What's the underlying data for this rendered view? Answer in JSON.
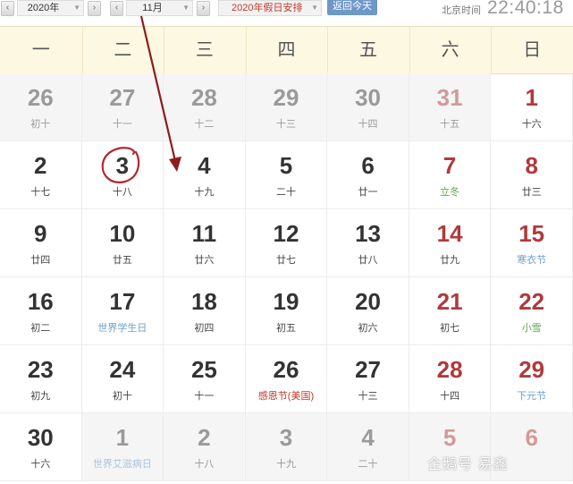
{
  "toolbar": {
    "year_value": "2020年",
    "month_value": "11月",
    "holiday_label": "2020年假日安排",
    "today_button": "返回今天",
    "beijing_label": "北京时间",
    "clock": "22:40:18"
  },
  "weekdays": [
    "一",
    "二",
    "三",
    "四",
    "五",
    "六",
    "日"
  ],
  "weeks": [
    [
      {
        "day": "26",
        "sub": "初十",
        "other": true
      },
      {
        "day": "27",
        "sub": "十一",
        "other": true
      },
      {
        "day": "28",
        "sub": "十二",
        "other": true
      },
      {
        "day": "29",
        "sub": "十三",
        "other": true
      },
      {
        "day": "30",
        "sub": "十四",
        "other": true
      },
      {
        "day": "31",
        "sub": "十五",
        "other": true,
        "weekend": true
      },
      {
        "day": "1",
        "sub": "十六",
        "weekend": true
      }
    ],
    [
      {
        "day": "2",
        "sub": "十七"
      },
      {
        "day": "3",
        "sub": "十八"
      },
      {
        "day": "4",
        "sub": "十九"
      },
      {
        "day": "5",
        "sub": "二十"
      },
      {
        "day": "6",
        "sub": "廿一"
      },
      {
        "day": "7",
        "sub": "立冬",
        "weekend": true,
        "subType": "term"
      },
      {
        "day": "8",
        "sub": "廿三",
        "weekend": true
      }
    ],
    [
      {
        "day": "9",
        "sub": "廿四"
      },
      {
        "day": "10",
        "sub": "廿五"
      },
      {
        "day": "11",
        "sub": "廿六"
      },
      {
        "day": "12",
        "sub": "廿七"
      },
      {
        "day": "13",
        "sub": "廿八"
      },
      {
        "day": "14",
        "sub": "廿九",
        "weekend": true
      },
      {
        "day": "15",
        "sub": "寒衣节",
        "weekend": true,
        "subType": "intl"
      }
    ],
    [
      {
        "day": "16",
        "sub": "初二"
      },
      {
        "day": "17",
        "sub": "世界学生日",
        "subType": "intl"
      },
      {
        "day": "18",
        "sub": "初四"
      },
      {
        "day": "19",
        "sub": "初五"
      },
      {
        "day": "20",
        "sub": "初六"
      },
      {
        "day": "21",
        "sub": "初七",
        "weekend": true
      },
      {
        "day": "22",
        "sub": "小雪",
        "weekend": true,
        "subType": "term"
      }
    ],
    [
      {
        "day": "23",
        "sub": "初九"
      },
      {
        "day": "24",
        "sub": "初十"
      },
      {
        "day": "25",
        "sub": "十一"
      },
      {
        "day": "26",
        "sub": "感恩节(美国)",
        "subType": "fest"
      },
      {
        "day": "27",
        "sub": "十三"
      },
      {
        "day": "28",
        "sub": "十四",
        "weekend": true
      },
      {
        "day": "29",
        "sub": "下元节",
        "weekend": true,
        "subType": "intl"
      }
    ],
    [
      {
        "day": "30",
        "sub": "十六"
      },
      {
        "day": "1",
        "sub": "世界艾滋病日",
        "other": true,
        "subType": "intl-faded"
      },
      {
        "day": "2",
        "sub": "十八",
        "other": true
      },
      {
        "day": "3",
        "sub": "十九",
        "other": true
      },
      {
        "day": "4",
        "sub": "二十",
        "other": true
      },
      {
        "day": "5",
        "sub": "",
        "other": true,
        "weekend": true
      },
      {
        "day": "6",
        "sub": "",
        "other": true,
        "weekend": true
      }
    ]
  ],
  "annotation": {
    "circled_day": "3",
    "color": "#b5262d"
  },
  "watermark": "企鹅号 易鑫"
}
